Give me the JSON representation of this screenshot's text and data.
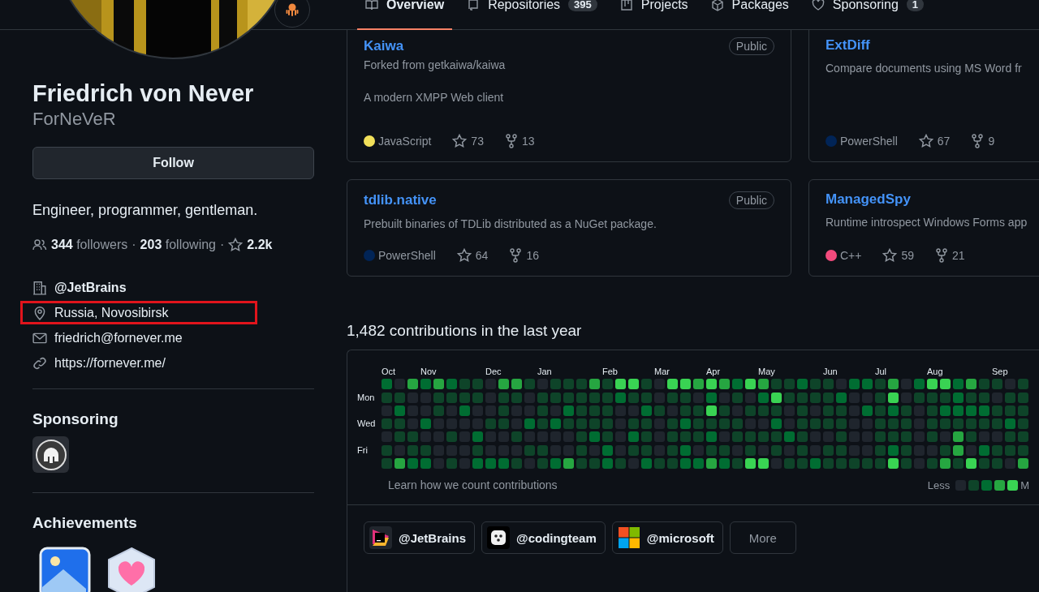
{
  "tabs": [
    {
      "label": "Overview",
      "selected": true
    },
    {
      "label": "Repositories",
      "count": "395",
      "selected": false
    },
    {
      "label": "Projects",
      "selected": false
    },
    {
      "label": "Packages",
      "selected": false
    },
    {
      "label": "Sponsoring",
      "count": "1",
      "selected": false
    }
  ],
  "profile": {
    "name": "Friedrich von Never",
    "username": "ForNeVeR",
    "follow_button": "Follow",
    "bio": "Engineer, programmer, gentleman.",
    "followers": {
      "count": "344",
      "label": "followers"
    },
    "following": {
      "count": "203",
      "label": "following"
    },
    "separators": [
      "·",
      "·"
    ],
    "star_count": "2.2k",
    "details": [
      {
        "kind": "organization",
        "text": "@JetBrains",
        "highlighted": false
      },
      {
        "kind": "location",
        "text": "Russia, Novosibirsk",
        "highlighted": true
      },
      {
        "kind": "email",
        "text": "friedrich@fornever.me",
        "highlighted": false
      },
      {
        "kind": "website",
        "text": "https://fornever.me/",
        "highlighted": false
      }
    ],
    "sponsoring_title": "Sponsoring",
    "achievements_title": "Achievements"
  },
  "pinned": [
    {
      "name": "Kaiwa",
      "visibility": "Public",
      "forked_from": "Forked from getkaiwa/kaiwa",
      "description": "A modern XMPP Web client",
      "language": "JavaScript",
      "color": "#f1e05a",
      "star_count": "73",
      "fork_count": "13"
    },
    {
      "name": "ExtDiff",
      "description": "Compare documents using MS Word fr",
      "language": "PowerShell",
      "color": "#012456",
      "star_count": "67",
      "fork_count": "9"
    },
    {
      "name": "tdlib.native",
      "visibility": "Public",
      "description": "Prebuilt binaries of TDLib distributed as a NuGet package.",
      "language": "PowerShell",
      "color": "#012456",
      "star_count": "64",
      "fork_count": "16"
    },
    {
      "name": "ManagedSpy",
      "description": "Runtime introspect Windows Forms app",
      "language": "C++",
      "color": "#f34b7d",
      "star_count": "59",
      "fork_count": "21"
    }
  ],
  "contributions": {
    "title": "1,482 contributions in the last year",
    "day_labels": [
      "Mon",
      "Wed",
      "Fri"
    ],
    "weeks": [
      {
        "month": "Oct",
        "days": [
          {
            "color": "#006d32"
          },
          {
            "color": "#0e4429"
          },
          {
            "color": "#1f252d"
          },
          {
            "color": "#0e4429"
          },
          {
            "color": "#1f252d"
          },
          {
            "color": "#0e4429"
          },
          {
            "color": "#0e4429"
          }
        ]
      },
      {
        "days": [
          {
            "color": "#1f252d"
          },
          {
            "color": "#0e4429"
          },
          {
            "color": "#006d32"
          },
          {
            "color": "#0e4429"
          },
          {
            "color": "#0e4429"
          },
          {
            "color": "#1f252d"
          },
          {
            "color": "#26a641"
          }
        ]
      },
      {
        "days": [
          {
            "color": "#26a641"
          },
          {
            "color": "#1f252d"
          },
          {
            "color": "#1f252d"
          },
          {
            "color": "#1f252d"
          },
          {
            "color": "#0e4429"
          },
          {
            "color": "#0e4429"
          },
          {
            "color": "#006d32"
          }
        ]
      },
      {
        "month": "Nov",
        "days": [
          {
            "color": "#006d32"
          },
          {
            "color": "#1f252d"
          },
          {
            "color": "#1f252d"
          },
          {
            "color": "#006d32"
          },
          {
            "color": "#1f252d"
          },
          {
            "color": "#0e4429"
          },
          {
            "color": "#006d32"
          }
        ]
      },
      {
        "days": [
          {
            "color": "#26a641"
          },
          {
            "color": "#0e4429"
          },
          {
            "color": "#0e4429"
          },
          {
            "color": "#1f252d"
          },
          {
            "color": "#1f252d"
          },
          {
            "color": "#1f252d"
          },
          {
            "color": "#1f252d"
          }
        ]
      },
      {
        "days": [
          {
            "color": "#006d32"
          },
          {
            "color": "#0e4429"
          },
          {
            "color": "#1f252d"
          },
          {
            "color": "#1f252d"
          },
          {
            "color": "#0e4429"
          },
          {
            "color": "#1f252d"
          },
          {
            "color": "#0e4429"
          }
        ]
      },
      {
        "days": [
          {
            "color": "#0e4429"
          },
          {
            "color": "#0e4429"
          },
          {
            "color": "#006d32"
          },
          {
            "color": "#1f252d"
          },
          {
            "color": "#1f252d"
          },
          {
            "color": "#1f252d"
          },
          {
            "color": "#1f252d"
          }
        ]
      },
      {
        "days": [
          {
            "color": "#0e4429"
          },
          {
            "color": "#0e4429"
          },
          {
            "color": "#1f252d"
          },
          {
            "color": "#1f252d"
          },
          {
            "color": "#006d32"
          },
          {
            "color": "#0e4429"
          },
          {
            "color": "#006d32"
          }
        ]
      },
      {
        "month": "Dec",
        "days": [
          {
            "color": "#1f252d"
          },
          {
            "color": "#1f252d"
          },
          {
            "color": "#1f252d"
          },
          {
            "color": "#0e4429"
          },
          {
            "color": "#1f252d"
          },
          {
            "color": "#1f252d"
          },
          {
            "color": "#006d32"
          }
        ]
      },
      {
        "days": [
          {
            "color": "#26a641"
          },
          {
            "color": "#0e4429"
          },
          {
            "color": "#0e4429"
          },
          {
            "color": "#0e4429"
          },
          {
            "color": "#1f252d"
          },
          {
            "color": "#1f252d"
          },
          {
            "color": "#006d32"
          }
        ]
      },
      {
        "days": [
          {
            "color": "#26a641"
          },
          {
            "color": "#0e4429"
          },
          {
            "color": "#1f252d"
          },
          {
            "color": "#1f252d"
          },
          {
            "color": "#0e4429"
          },
          {
            "color": "#1f252d"
          },
          {
            "color": "#0e4429"
          }
        ]
      },
      {
        "days": [
          {
            "color": "#0e4429"
          },
          {
            "color": "#1f252d"
          },
          {
            "color": "#1f252d"
          },
          {
            "color": "#006d32"
          },
          {
            "color": "#1f252d"
          },
          {
            "color": "#0e4429"
          },
          {
            "color": "#1f252d"
          }
        ]
      },
      {
        "month": "Jan",
        "days": [
          {
            "color": "#1f252d"
          },
          {
            "color": "#0e4429"
          },
          {
            "color": "#0e4429"
          },
          {
            "color": "#0e4429"
          },
          {
            "color": "#1f252d"
          },
          {
            "color": "#0e4429"
          },
          {
            "color": "#0e4429"
          }
        ]
      },
      {
        "days": [
          {
            "color": "#0e4429"
          },
          {
            "color": "#0e4429"
          },
          {
            "color": "#1f252d"
          },
          {
            "color": "#006d32"
          },
          {
            "color": "#1f252d"
          },
          {
            "color": "#1f252d"
          },
          {
            "color": "#006d32"
          }
        ]
      },
      {
        "days": [
          {
            "color": "#0e4429"
          },
          {
            "color": "#0e4429"
          },
          {
            "color": "#006d32"
          },
          {
            "color": "#0e4429"
          },
          {
            "color": "#1f252d"
          },
          {
            "color": "#1f252d"
          },
          {
            "color": "#26a641"
          }
        ]
      },
      {
        "days": [
          {
            "color": "#0e4429"
          },
          {
            "color": "#0e4429"
          },
          {
            "color": "#0e4429"
          },
          {
            "color": "#0e4429"
          },
          {
            "color": "#0e4429"
          },
          {
            "color": "#0e4429"
          },
          {
            "color": "#0e4429"
          }
        ]
      },
      {
        "days": [
          {
            "color": "#26a641"
          },
          {
            "color": "#0e4429"
          },
          {
            "color": "#0e4429"
          },
          {
            "color": "#0e4429"
          },
          {
            "color": "#006d32"
          },
          {
            "color": "#1f252d"
          },
          {
            "color": "#0e4429"
          }
        ]
      },
      {
        "month": "Feb",
        "days": [
          {
            "color": "#0e4429"
          },
          {
            "color": "#0e4429"
          },
          {
            "color": "#0e4429"
          },
          {
            "color": "#0e4429"
          },
          {
            "color": "#0e4429"
          },
          {
            "color": "#006d32"
          },
          {
            "color": "#006d32"
          }
        ]
      },
      {
        "days": [
          {
            "color": "#39d353"
          },
          {
            "color": "#006d32"
          },
          {
            "color": "#1f252d"
          },
          {
            "color": "#1f252d"
          },
          {
            "color": "#1f252d"
          },
          {
            "color": "#1f252d"
          },
          {
            "color": "#0e4429"
          }
        ]
      },
      {
        "days": [
          {
            "color": "#39d353"
          },
          {
            "color": "#0e4429"
          },
          {
            "color": "#1f252d"
          },
          {
            "color": "#0e4429"
          },
          {
            "color": "#006d32"
          },
          {
            "color": "#0e4429"
          },
          {
            "color": "#1f252d"
          }
        ]
      },
      {
        "days": [
          {
            "color": "#0e4429"
          },
          {
            "color": "#0e4429"
          },
          {
            "color": "#006d32"
          },
          {
            "color": "#0e4429"
          },
          {
            "color": "#0e4429"
          },
          {
            "color": "#0e4429"
          },
          {
            "color": "#006d32"
          }
        ]
      },
      {
        "month": "Mar",
        "days": [
          {
            "color": "#1f252d"
          },
          {
            "color": "#1f252d"
          },
          {
            "color": "#0e4429"
          },
          {
            "color": "#1f252d"
          },
          {
            "color": "#1f252d"
          },
          {
            "color": "#1f252d"
          },
          {
            "color": "#0e4429"
          }
        ]
      },
      {
        "days": [
          {
            "color": "#39d353"
          },
          {
            "color": "#0e4429"
          },
          {
            "color": "#1f252d"
          },
          {
            "color": "#0e4429"
          },
          {
            "color": "#0e4429"
          },
          {
            "color": "#0e4429"
          },
          {
            "color": "#0e4429"
          }
        ]
      },
      {
        "days": [
          {
            "color": "#39d353"
          },
          {
            "color": "#0e4429"
          },
          {
            "color": "#0e4429"
          },
          {
            "color": "#006d32"
          },
          {
            "color": "#0e4429"
          },
          {
            "color": "#006d32"
          },
          {
            "color": "#006d32"
          }
        ]
      },
      {
        "days": [
          {
            "color": "#26a641"
          },
          {
            "color": "#1f252d"
          },
          {
            "color": "#0e4429"
          },
          {
            "color": "#0e4429"
          },
          {
            "color": "#0e4429"
          },
          {
            "color": "#1f252d"
          },
          {
            "color": "#006d32"
          }
        ]
      },
      {
        "month": "Apr",
        "days": [
          {
            "color": "#39d353"
          },
          {
            "color": "#006d32"
          },
          {
            "color": "#39d353"
          },
          {
            "color": "#0e4429"
          },
          {
            "color": "#006d32"
          },
          {
            "color": "#0e4429"
          },
          {
            "color": "#26a641"
          }
        ]
      },
      {
        "days": [
          {
            "color": "#26a641"
          },
          {
            "color": "#1f252d"
          },
          {
            "color": "#0e4429"
          },
          {
            "color": "#0e4429"
          },
          {
            "color": "#1f252d"
          },
          {
            "color": "#0e4429"
          },
          {
            "color": "#006d32"
          }
        ]
      },
      {
        "days": [
          {
            "color": "#006d32"
          },
          {
            "color": "#0e4429"
          },
          {
            "color": "#1f252d"
          },
          {
            "color": "#0e4429"
          },
          {
            "color": "#0e4429"
          },
          {
            "color": "#1f252d"
          },
          {
            "color": "#0e4429"
          }
        ]
      },
      {
        "days": [
          {
            "color": "#39d353"
          },
          {
            "color": "#1f252d"
          },
          {
            "color": "#0e4429"
          },
          {
            "color": "#1f252d"
          },
          {
            "color": "#0e4429"
          },
          {
            "color": "#0e4429"
          },
          {
            "color": "#39d353"
          }
        ]
      },
      {
        "month": "May",
        "days": [
          {
            "color": "#26a641"
          },
          {
            "color": "#006d32"
          },
          {
            "color": "#0e4429"
          },
          {
            "color": "#1f252d"
          },
          {
            "color": "#0e4429"
          },
          {
            "color": "#1f252d"
          },
          {
            "color": "#39d353"
          }
        ]
      },
      {
        "days": [
          {
            "color": "#0e4429"
          },
          {
            "color": "#39d353"
          },
          {
            "color": "#0e4429"
          },
          {
            "color": "#006d32"
          },
          {
            "color": "#0e4429"
          },
          {
            "color": "#0e4429"
          },
          {
            "color": "#1f252d"
          }
        ]
      },
      {
        "days": [
          {
            "color": "#0e4429"
          },
          {
            "color": "#0e4429"
          },
          {
            "color": "#1f252d"
          },
          {
            "color": "#1f252d"
          },
          {
            "color": "#006d32"
          },
          {
            "color": "#1f252d"
          },
          {
            "color": "#0e4429"
          }
        ]
      },
      {
        "days": [
          {
            "color": "#006d32"
          },
          {
            "color": "#0e4429"
          },
          {
            "color": "#0e4429"
          },
          {
            "color": "#0e4429"
          },
          {
            "color": "#0e4429"
          },
          {
            "color": "#0e4429"
          },
          {
            "color": "#0e4429"
          }
        ]
      },
      {
        "days": [
          {
            "color": "#0e4429"
          },
          {
            "color": "#0e4429"
          },
          {
            "color": "#1f252d"
          },
          {
            "color": "#0e4429"
          },
          {
            "color": "#1f252d"
          },
          {
            "color": "#1f252d"
          },
          {
            "color": "#006d32"
          }
        ]
      },
      {
        "month": "Jun",
        "days": [
          {
            "color": "#0e4429"
          },
          {
            "color": "#0e4429"
          },
          {
            "color": "#0e4429"
          },
          {
            "color": "#0e4429"
          },
          {
            "color": "#1f252d"
          },
          {
            "color": "#0e4429"
          },
          {
            "color": "#0e4429"
          }
        ]
      },
      {
        "days": [
          {
            "color": "#1f252d"
          },
          {
            "color": "#006d32"
          },
          {
            "color": "#0e4429"
          },
          {
            "color": "#0e4429"
          },
          {
            "color": "#0e4429"
          },
          {
            "color": "#0e4429"
          },
          {
            "color": "#0e4429"
          }
        ]
      },
      {
        "days": [
          {
            "color": "#006d32"
          },
          {
            "color": "#1f252d"
          },
          {
            "color": "#1f252d"
          },
          {
            "color": "#1f252d"
          },
          {
            "color": "#1f252d"
          },
          {
            "color": "#1f252d"
          },
          {
            "color": "#0e4429"
          }
        ]
      },
      {
        "days": [
          {
            "color": "#006d32"
          },
          {
            "color": "#1f252d"
          },
          {
            "color": "#006d32"
          },
          {
            "color": "#1f252d"
          },
          {
            "color": "#1f252d"
          },
          {
            "color": "#1f252d"
          },
          {
            "color": "#0e4429"
          }
        ]
      },
      {
        "month": "Jul",
        "days": [
          {
            "color": "#0e4429"
          },
          {
            "color": "#0e4429"
          },
          {
            "color": "#0e4429"
          },
          {
            "color": "#0e4429"
          },
          {
            "color": "#0e4429"
          },
          {
            "color": "#0e4429"
          },
          {
            "color": "#0e4429"
          }
        ]
      },
      {
        "days": [
          {
            "color": "#26a641"
          },
          {
            "color": "#39d353"
          },
          {
            "color": "#006d32"
          },
          {
            "color": "#0e4429"
          },
          {
            "color": "#0e4429"
          },
          {
            "color": "#006d32"
          },
          {
            "color": "#39d353"
          }
        ]
      },
      {
        "days": [
          {
            "color": "#1f252d"
          },
          {
            "color": "#1f252d"
          },
          {
            "color": "#0e4429"
          },
          {
            "color": "#0e4429"
          },
          {
            "color": "#0e4429"
          },
          {
            "color": "#0e4429"
          },
          {
            "color": "#0e4429"
          }
        ]
      },
      {
        "days": [
          {
            "color": "#006d32"
          },
          {
            "color": "#0e4429"
          },
          {
            "color": "#1f252d"
          },
          {
            "color": "#1f252d"
          },
          {
            "color": "#1f252d"
          },
          {
            "color": "#1f252d"
          },
          {
            "color": "#1f252d"
          }
        ]
      },
      {
        "month": "Aug",
        "days": [
          {
            "color": "#39d353"
          },
          {
            "color": "#0e4429"
          },
          {
            "color": "#0e4429"
          },
          {
            "color": "#0e4429"
          },
          {
            "color": "#0e4429"
          },
          {
            "color": "#1f252d"
          },
          {
            "color": "#0e4429"
          }
        ]
      },
      {
        "days": [
          {
            "color": "#39d353"
          },
          {
            "color": "#0e4429"
          },
          {
            "color": "#006d32"
          },
          {
            "color": "#0e4429"
          },
          {
            "color": "#1f252d"
          },
          {
            "color": "#0e4429"
          },
          {
            "color": "#26a641"
          }
        ]
      },
      {
        "days": [
          {
            "color": "#006d32"
          },
          {
            "color": "#006d32"
          },
          {
            "color": "#006d32"
          },
          {
            "color": "#0e4429"
          },
          {
            "color": "#26a641"
          },
          {
            "color": "#26a641"
          },
          {
            "color": "#0e4429"
          }
        ]
      },
      {
        "days": [
          {
            "color": "#26a641"
          },
          {
            "color": "#0e4429"
          },
          {
            "color": "#006d32"
          },
          {
            "color": "#0e4429"
          },
          {
            "color": "#0e4429"
          },
          {
            "color": "#1f252d"
          },
          {
            "color": "#39d353"
          }
        ]
      },
      {
        "days": [
          {
            "color": "#0e4429"
          },
          {
            "color": "#0e4429"
          },
          {
            "color": "#006d32"
          },
          {
            "color": "#0e4429"
          },
          {
            "color": "#1f252d"
          },
          {
            "color": "#006d32"
          },
          {
            "color": "#0e4429"
          }
        ]
      },
      {
        "month": "Sep",
        "days": [
          {
            "color": "#0e4429"
          },
          {
            "color": "#1f252d"
          },
          {
            "color": "#0e4429"
          },
          {
            "color": "#0e4429"
          },
          {
            "color": "#1f252d"
          },
          {
            "color": "#0e4429"
          },
          {
            "color": "#0e4429"
          }
        ]
      },
      {
        "days": [
          {
            "color": "#1f252d"
          },
          {
            "color": "#0e4429"
          },
          {
            "color": "#0e4429"
          },
          {
            "color": "#006d32"
          },
          {
            "color": "#0e4429"
          },
          {
            "color": "#0e4429"
          },
          {
            "color": "#1f252d"
          }
        ]
      },
      {
        "days": [
          {
            "color": "#0e4429"
          },
          {
            "color": "#0e4429"
          },
          {
            "color": "#0e4429"
          },
          {
            "color": "#0e4429"
          },
          {
            "color": "#0e4429"
          },
          {
            "color": "#0e4429"
          },
          {
            "color": "#26a641"
          }
        ]
      }
    ],
    "footer_link": "Learn how we count contributions",
    "legend_less": "Less",
    "legend_more": "M"
  },
  "organizations": [
    {
      "name": "@JetBrains"
    },
    {
      "name": "@codingteam"
    },
    {
      "name": "@microsoft"
    }
  ],
  "more_button": "More"
}
